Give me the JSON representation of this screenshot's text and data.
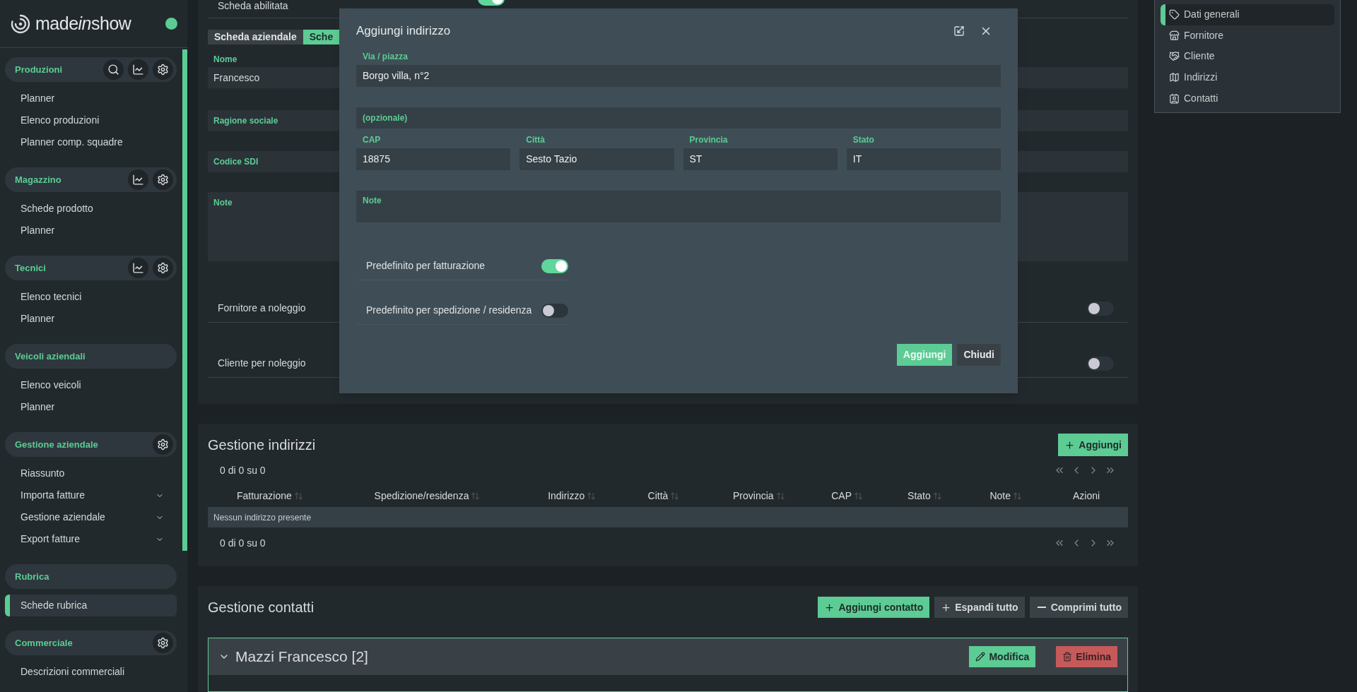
{
  "sidebar": {
    "logo": {
      "start": "made",
      "italic": "in",
      "end": "show"
    },
    "sections": [
      {
        "title": "Produzioni",
        "actions": [
          {
            "kind": "search"
          },
          {
            "kind": "chart"
          },
          {
            "kind": "settings"
          }
        ],
        "items": [
          {
            "label": "Planner",
            "expandable": false,
            "selected": false
          },
          {
            "label": "Elenco produzioni",
            "expandable": false,
            "selected": false
          },
          {
            "label": "Planner comp. squadre",
            "expandable": false,
            "selected": false
          }
        ]
      },
      {
        "title": "Magazzino",
        "actions": [
          {
            "kind": "chart"
          },
          {
            "kind": "settings"
          }
        ],
        "items": [
          {
            "label": "Schede prodotto",
            "expandable": false,
            "selected": false
          },
          {
            "label": "Planner",
            "expandable": false,
            "selected": false
          }
        ]
      },
      {
        "title": "Tecnici",
        "actions": [
          {
            "kind": "chart"
          },
          {
            "kind": "settings"
          }
        ],
        "items": [
          {
            "label": "Elenco tecnici",
            "expandable": false,
            "selected": false
          },
          {
            "label": "Planner",
            "expandable": false,
            "selected": false
          }
        ]
      },
      {
        "title": "Veicoli aziendali",
        "items": [
          {
            "label": "Elenco veicoli",
            "expandable": false,
            "selected": false
          },
          {
            "label": "Planner",
            "expandable": false,
            "selected": false
          }
        ]
      },
      {
        "title": "Gestione aziendale",
        "actions": [
          {
            "kind": "settings"
          }
        ],
        "items": [
          {
            "label": "Riassunto",
            "expandable": false,
            "selected": false
          },
          {
            "label": "Importa fatture",
            "expandable": true,
            "selected": false
          },
          {
            "label": "Gestione aziendale",
            "expandable": true,
            "selected": false
          },
          {
            "label": "Export fatture",
            "expandable": true,
            "selected": false
          }
        ]
      },
      {
        "title": "Rubrica",
        "items": [
          {
            "label": "Schede rubrica",
            "expandable": false,
            "selected": true
          }
        ]
      },
      {
        "title": "Commerciale",
        "actions": [
          {
            "kind": "settings"
          }
        ],
        "items": [
          {
            "label": "Descrizioni commerciali",
            "expandable": false,
            "selected": false
          }
        ]
      }
    ]
  },
  "form": {
    "enabled": {
      "label": "Scheda abilitata",
      "on": true
    },
    "tabs": [
      {
        "label": "Scheda aziendale",
        "selected": false
      },
      {
        "label": "Sche",
        "selected": true
      }
    ],
    "fields": [
      {
        "kind": "input",
        "label": "Nome",
        "value": "Francesco"
      },
      {
        "kind": "boxed",
        "label": "Ragione sociale"
      },
      {
        "kind": "boxed",
        "label": "Codice SDI"
      },
      {
        "kind": "textarea",
        "label": "Note"
      }
    ],
    "toggles": [
      {
        "label": "Fornitore a noleggio",
        "on": false
      },
      {
        "label": "Cliente per noleggio",
        "on": false
      }
    ]
  },
  "nav": [
    {
      "label": "Dati generali",
      "kind": "tag",
      "selected": true
    },
    {
      "label": "Fornitore",
      "kind": "store",
      "selected": false
    },
    {
      "label": "Cliente",
      "kind": "handshake",
      "selected": false
    },
    {
      "label": "Indirizzi",
      "kind": "map",
      "selected": false
    },
    {
      "label": "Contatti",
      "kind": "contact",
      "selected": false
    }
  ],
  "addresses": {
    "title": "Gestione indirizzi",
    "add_button": "Aggiungi",
    "pager_top": "0 di 0 su 0",
    "pager_bottom": "0 di 0 su 0",
    "columns": [
      {
        "label": "Fatturazione",
        "sortable": true
      },
      {
        "label": "Spedizione/residenza",
        "sortable": true
      },
      {
        "label": "Indirizzo",
        "sortable": true
      },
      {
        "label": "Città",
        "sortable": true
      },
      {
        "label": "Provincia",
        "sortable": true
      },
      {
        "label": "CAP",
        "sortable": true
      },
      {
        "label": "Stato",
        "sortable": true
      },
      {
        "label": "Note",
        "sortable": true
      },
      {
        "label": "Azioni",
        "sortable": false
      }
    ],
    "empty": "Nessun indirizzo presente"
  },
  "contacts": {
    "title": "Gestione contatti",
    "buttons": [
      {
        "label": "Aggiungi contatto",
        "kind": "add"
      },
      {
        "label": "Espandi tutto",
        "kind": "expand"
      },
      {
        "label": "Comprimi tutto",
        "kind": "collapse"
      }
    ],
    "card": {
      "name": "Mazzi Francesco [2]",
      "expanded": true,
      "edit": "Modifica",
      "delete": "Elimina"
    }
  },
  "modal": {
    "title": "Aggiungi indirizzo",
    "street": {
      "label": "Via / piazza",
      "value": "Borgo villa, n°2"
    },
    "optional": {
      "label": "(opzionale)"
    },
    "row": [
      {
        "label": "CAP",
        "value": "18875"
      },
      {
        "label": "Città",
        "value": "Sesto Tazio"
      },
      {
        "label": "Provincia",
        "value": "ST"
      },
      {
        "label": "Stato",
        "value": "IT"
      }
    ],
    "note": {
      "label": "Note"
    },
    "toggles": [
      {
        "label": "Predefinito per fatturazione",
        "on": true
      },
      {
        "label": "Predefinito per spedizione / residenza",
        "on": false
      }
    ],
    "buttons": [
      {
        "label": "Aggiungi",
        "kind": "primary"
      },
      {
        "label": "Chiudi",
        "kind": "secondary"
      }
    ]
  }
}
